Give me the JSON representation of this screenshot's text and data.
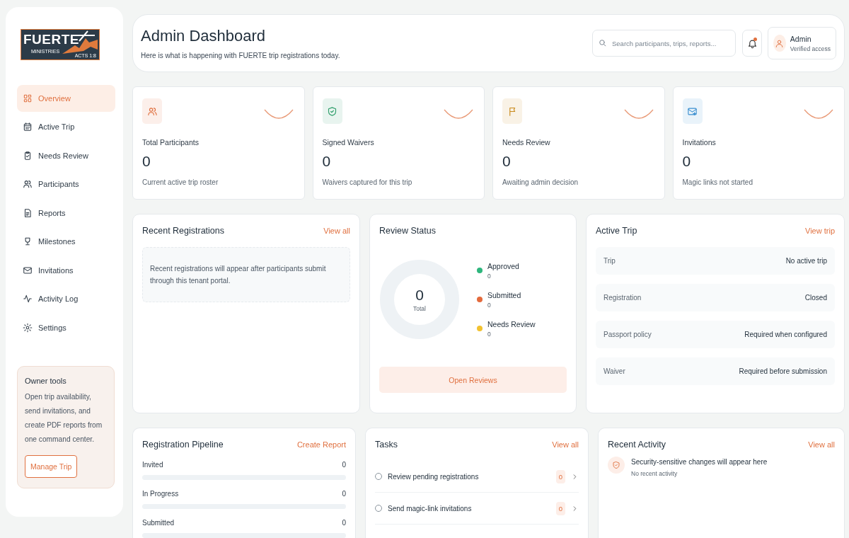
{
  "sidebar": {
    "logo": {
      "title": "FUERTE",
      "subtitle": "MINISTRIES",
      "verse": "ACTS 1:8"
    },
    "nav": [
      {
        "label": "Overview",
        "selected": true
      },
      {
        "label": "Active Trip",
        "selected": false
      },
      {
        "label": "Needs Review",
        "selected": false
      },
      {
        "label": "Participants",
        "selected": false
      },
      {
        "label": "Reports",
        "selected": false
      },
      {
        "label": "Milestones",
        "selected": false
      },
      {
        "label": "Invitations",
        "selected": false
      },
      {
        "label": "Activity Log",
        "selected": false
      },
      {
        "label": "Settings",
        "selected": false
      }
    ],
    "owner_tools": {
      "title": "Owner tools",
      "text": "Open trip availability, send invitations, and create PDF reports from one command center.",
      "button": "Manage Trip"
    }
  },
  "header": {
    "title": "Admin Dashboard",
    "subtitle": "Here is what is happening with FUERTE trip registrations today.",
    "search": {
      "placeholder": "Search participants, trips, reports..."
    },
    "notifications": {
      "unread": true
    },
    "user": {
      "name": "Admin",
      "role": "Verified access"
    }
  },
  "stats": [
    {
      "label": "Total Participants",
      "value": "0",
      "note": "Current active trip roster",
      "color": "#e0703f"
    },
    {
      "label": "Signed Waivers",
      "value": "0",
      "note": "Waivers captured for this trip",
      "color": "#2e9e6a"
    },
    {
      "label": "Needs Review",
      "value": "0",
      "note": "Awaiting admin decision",
      "color": "#c98a1a"
    },
    {
      "label": "Invitations",
      "value": "0",
      "note": "Magic links not started",
      "color": "#3a8fd0"
    }
  ],
  "recent_registrations": {
    "title": "Recent Registrations",
    "link": "View all",
    "empty_text": "Recent registrations will appear after participants submit through this tenant portal."
  },
  "review_status": {
    "title": "Review Status",
    "total": "0",
    "total_label": "Total",
    "legend": [
      {
        "label": "Approved",
        "count": "0",
        "color": "#2eb67d"
      },
      {
        "label": "Submitted",
        "count": "0",
        "color": "#e46a3c"
      },
      {
        "label": "Needs Review",
        "count": "0",
        "color": "#f2c230"
      }
    ],
    "button": "Open Reviews"
  },
  "active_trip": {
    "title": "Active Trip",
    "link": "View trip",
    "rows": [
      {
        "label": "Trip",
        "value": "No active trip"
      },
      {
        "label": "Registration",
        "value": "Closed"
      },
      {
        "label": "Passport policy",
        "value": "Required when configured"
      },
      {
        "label": "Waiver",
        "value": "Required before submission"
      }
    ]
  },
  "pipeline": {
    "title": "Registration Pipeline",
    "link": "Create Report",
    "stages": [
      {
        "label": "Invited",
        "count": "0",
        "level": 0
      },
      {
        "label": "In Progress",
        "count": "0",
        "level": 0
      },
      {
        "label": "Submitted",
        "count": "0",
        "level": 0
      }
    ]
  },
  "tasks": {
    "title": "Tasks",
    "link": "View all",
    "items": [
      {
        "label": "Review pending registrations",
        "count": "0",
        "checked": false
      },
      {
        "label": "Send magic-link invitations",
        "count": "0",
        "checked": false
      }
    ]
  },
  "recent_activity": {
    "title": "Recent Activity",
    "link": "View all",
    "items": [
      {
        "title": "Security-sensitive changes will appear here",
        "subtitle": "No recent activity"
      }
    ]
  }
}
